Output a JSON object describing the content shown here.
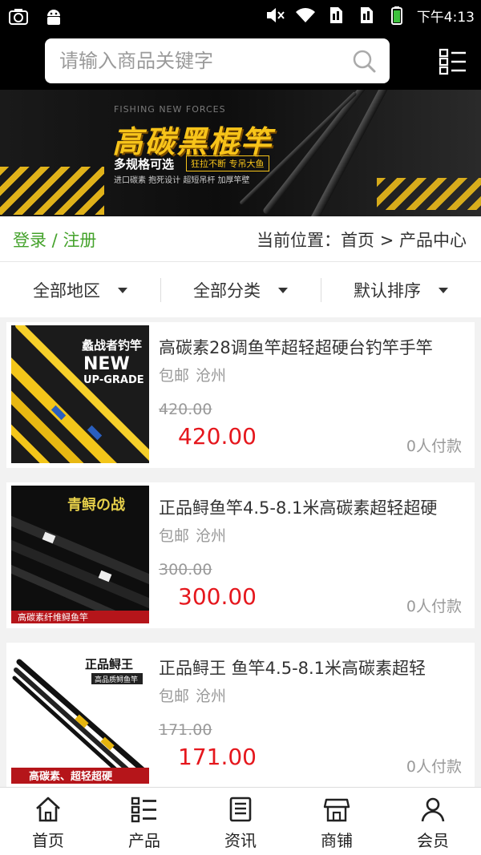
{
  "status_bar": {
    "time": "下午4:13",
    "left_icons": [
      "camera-icon",
      "android-icon"
    ],
    "right_icons": [
      "mute-icon",
      "wifi-icon",
      "sim1-icon",
      "sim2-icon",
      "battery-icon"
    ]
  },
  "search": {
    "placeholder": "请输入商品关键字",
    "value": ""
  },
  "banner": {
    "sub_en": "FISHING NEW FORCES",
    "title": "高碳黑棍竿",
    "line2": "多规格可选",
    "tag": "狂拉不断 专吊大鱼",
    "line3": "进口碳素  抱死设计  超短吊杆  加厚竿壁"
  },
  "auth": {
    "login": "登录",
    "sep": " / ",
    "register": "注册"
  },
  "breadcrumb": "当前位置：首页 > 产品中心",
  "filters": [
    {
      "label": "全部地区"
    },
    {
      "label": "全部分类"
    },
    {
      "label": "默认排序"
    }
  ],
  "products": [
    {
      "title": "高碳素28调鱼竿超轻超硬台钓竿手竿",
      "shipping": "包邮",
      "city": "沧州",
      "old_price": "420.00",
      "price": "420.00",
      "sold": "0人付款",
      "thumb_text": {
        "a": "蠡战者钓竿",
        "b": "NEW",
        "c": "UP-GRADE"
      }
    },
    {
      "title": "正品鲟鱼竿4.5-8.1米高碳素超轻超硬",
      "shipping": "包邮",
      "city": "沧州",
      "old_price": "300.00",
      "price": "300.00",
      "sold": "0人付款",
      "thumb_text": {
        "a": "青鲟の战",
        "b": "高碳素纤维鲟鱼竿"
      }
    },
    {
      "title": "正品鲟王 鱼竿4.5-8.1米高碳素超轻",
      "shipping": "包邮",
      "city": "沧州",
      "old_price": "171.00",
      "price": "171.00",
      "sold": "0人付款",
      "thumb_text": {
        "a": "正品鲟王",
        "b": "高品质鲟鱼竿",
        "c": "高碳素、超轻超硬"
      }
    }
  ],
  "bottom_nav": [
    {
      "label": "首页",
      "icon": "home-icon"
    },
    {
      "label": "产品",
      "icon": "list-icon"
    },
    {
      "label": "资讯",
      "icon": "news-icon"
    },
    {
      "label": "商铺",
      "icon": "shop-icon"
    },
    {
      "label": "会员",
      "icon": "user-icon"
    }
  ],
  "colors": {
    "accent_green": "#44a22b",
    "price_red": "#e5171d",
    "banner_yellow": "#f7c41a"
  }
}
